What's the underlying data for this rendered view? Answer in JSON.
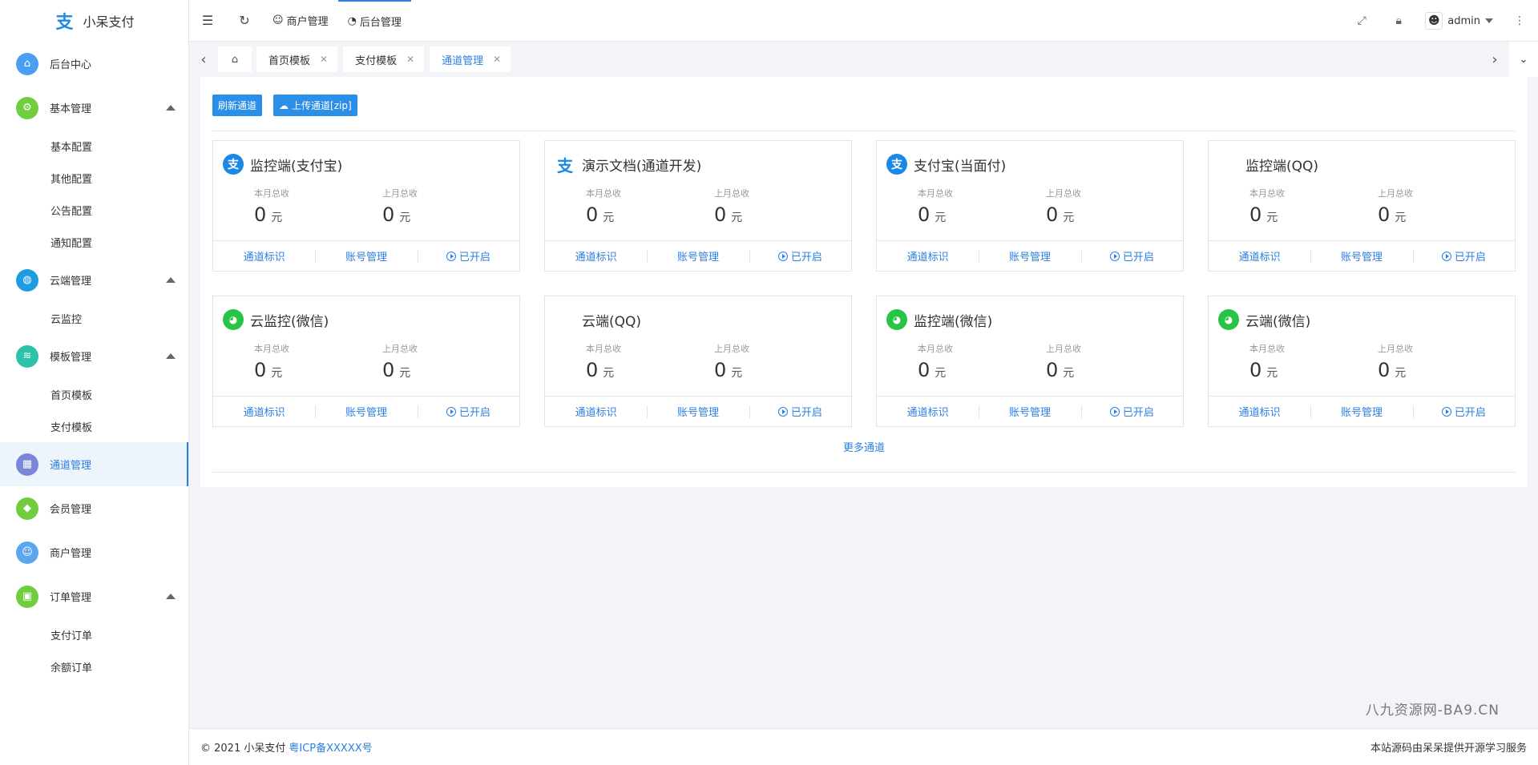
{
  "brand": {
    "name": "小呆支付",
    "logo_glyph": "支"
  },
  "sidebar": {
    "items": [
      {
        "label": "后台中心",
        "icon": "home-icon",
        "color": "#4b9ff2"
      },
      {
        "label": "基本管理",
        "icon": "gear-icon",
        "color": "#6fcd3e",
        "expanded": true,
        "children": [
          "基本配置",
          "其他配置",
          "公告配置",
          "通知配置"
        ]
      },
      {
        "label": "云端管理",
        "icon": "globe-icon",
        "color": "#1d9de0",
        "expanded": true,
        "children": [
          "云监控"
        ]
      },
      {
        "label": "模板管理",
        "icon": "layers-icon",
        "color": "#2cc1a8",
        "expanded": true,
        "children": [
          "首页模板",
          "支付模板"
        ]
      },
      {
        "label": "通道管理",
        "icon": "channel-icon",
        "color": "#7a86d8",
        "active": true
      },
      {
        "label": "会员管理",
        "icon": "diamond-icon",
        "color": "#6fcd3e"
      },
      {
        "label": "商户管理",
        "icon": "user-icon",
        "color": "#5aa7f0"
      },
      {
        "label": "订单管理",
        "icon": "cart-icon",
        "color": "#6fcd3e",
        "expanded": true,
        "children": [
          "支付订单",
          "余额订单"
        ]
      }
    ]
  },
  "header": {
    "links": [
      {
        "label": "商户管理",
        "icon": "user-icon"
      },
      {
        "label": "后台管理",
        "icon": "dashboard-icon",
        "active": true
      }
    ],
    "user": "admin"
  },
  "tabs": [
    {
      "label": "首页模板"
    },
    {
      "label": "支付模板"
    },
    {
      "label": "通道管理",
      "active": true
    }
  ],
  "toolbar": {
    "refresh_label": "刷新通道",
    "upload_label": "上传通道[zip]"
  },
  "card_labels": {
    "this_month": "本月总收",
    "last_month": "上月总收",
    "unit": "元",
    "action_id": "通道标识",
    "action_account": "账号管理",
    "action_status": "已开启"
  },
  "channels": [
    {
      "title": "监控端(支付宝)",
      "icon": "alipay-icon",
      "this_month": "0",
      "last_month": "0"
    },
    {
      "title": "演示文档(通道开发)",
      "icon": "alipay-plain-icon",
      "this_month": "0",
      "last_month": "0"
    },
    {
      "title": "支付宝(当面付)",
      "icon": "alipay-icon",
      "this_month": "0",
      "last_month": "0"
    },
    {
      "title": "监控端(QQ)",
      "icon": "qq-icon",
      "this_month": "0",
      "last_month": "0"
    },
    {
      "title": "云监控(微信)",
      "icon": "wechat-icon",
      "this_month": "0",
      "last_month": "0"
    },
    {
      "title": "云端(QQ)",
      "icon": "qq-icon",
      "this_month": "0",
      "last_month": "0"
    },
    {
      "title": "监控端(微信)",
      "icon": "wechat-icon",
      "this_month": "0",
      "last_month": "0"
    },
    {
      "title": "云端(微信)",
      "icon": "wechat-icon",
      "this_month": "0",
      "last_month": "0"
    }
  ],
  "more_label": "更多通道",
  "watermark": "八九资源网-BA9.CN",
  "footer": {
    "copyright": "© 2021 小呆支付",
    "icp": "粤ICP备XXXXX号",
    "right_text": "本站源码由呆呆提供开源学习服务"
  },
  "colors": {
    "accent": "#2b7fe3",
    "button": "#2b8fe8"
  }
}
